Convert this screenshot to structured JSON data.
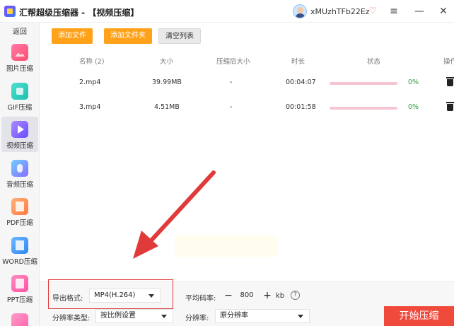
{
  "titlebar": {
    "title": "汇帮超级压缩器  - 【视频压缩】",
    "username": "xMUzhTFb22Ez",
    "menu_icon": "≡",
    "min_icon": "—",
    "close_icon": "✕"
  },
  "sidebar": {
    "back_label": "返回",
    "items": [
      {
        "label": "图片压缩",
        "icon": "image-icon"
      },
      {
        "label": "GIF压缩",
        "icon": "gif-icon"
      },
      {
        "label": "视频压缩",
        "icon": "video-icon",
        "active": true
      },
      {
        "label": "音频压缩",
        "icon": "audio-icon"
      },
      {
        "label": "PDF压缩",
        "icon": "pdf-icon"
      },
      {
        "label": "WORD压缩",
        "icon": "word-icon"
      },
      {
        "label": "PPT压缩",
        "icon": "ppt-icon"
      }
    ]
  },
  "toolbar": {
    "add_file": "添加文件",
    "add_folder": "添加文件夹",
    "clear_list": "清空列表"
  },
  "table": {
    "headers": {
      "name": "名称 (2)",
      "size": "大小",
      "compressed_size": "压缩后大小",
      "duration": "时长",
      "status": "状态",
      "action": "操作"
    },
    "rows": [
      {
        "name": "2.mp4",
        "size": "39.99MB",
        "compressed": "-",
        "duration": "00:04:07",
        "progress": "0%",
        "progress_fraction": 0
      },
      {
        "name": "3.mp4",
        "size": "4.51MB",
        "compressed": "-",
        "duration": "00:01:58",
        "progress": "0%",
        "progress_fraction": 0
      }
    ]
  },
  "settings": {
    "format_label": "导出格式:",
    "format_value": "MP4(H.264)",
    "bitrate_label": "平均码率:",
    "bitrate_minus": "−",
    "bitrate_value": "800",
    "bitrate_plus": "+",
    "bitrate_unit": "kb",
    "help": "?",
    "resolution_type_label": "分辨率类型:",
    "resolution_type_value": "按比例设置",
    "resolution_label": "分辨率:",
    "resolution_value": "原分辨率",
    "start_button": "开始压缩"
  },
  "colors": {
    "accent_orange": "#ffa21a",
    "start_red": "#ef4a3c",
    "progress_pink": "#e8547a",
    "progress_text_green": "#2e9e3a",
    "annotation_red": "#e03a3a"
  }
}
